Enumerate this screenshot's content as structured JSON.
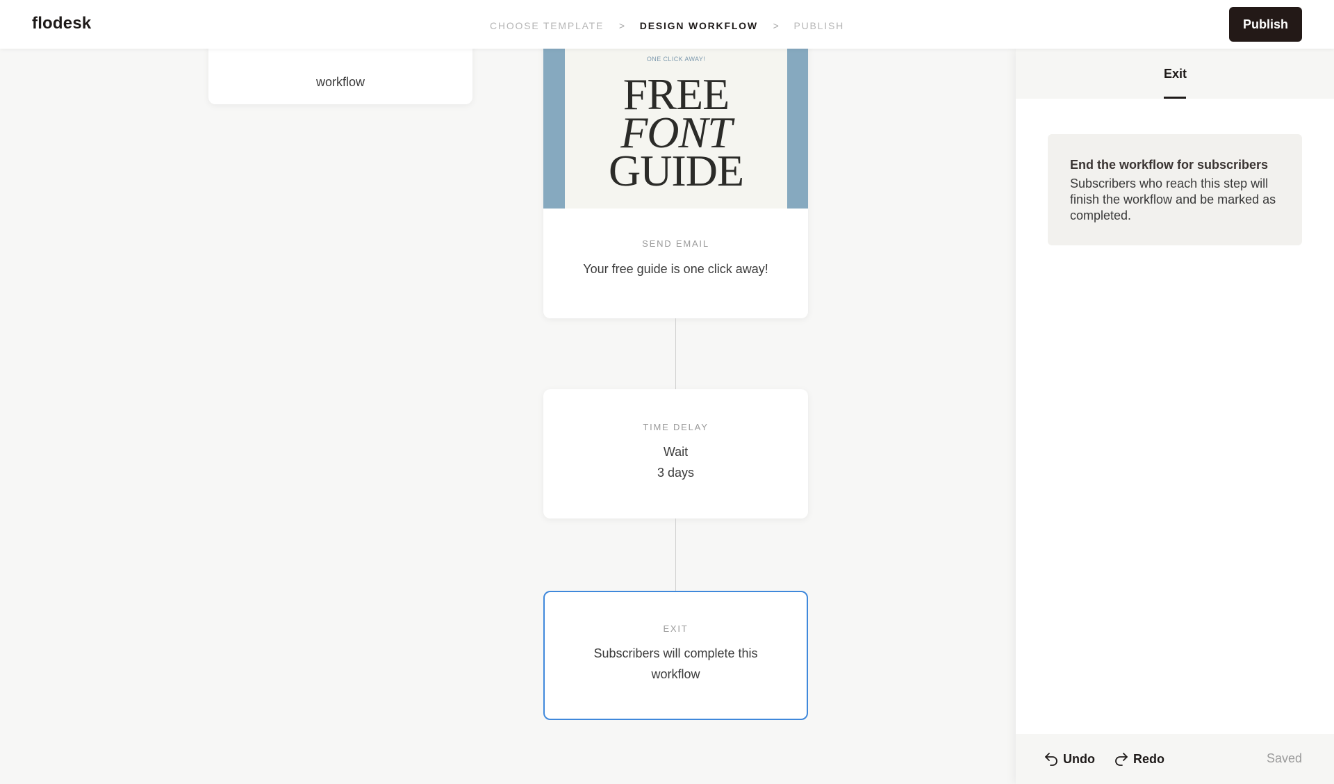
{
  "header": {
    "logo": "flodesk",
    "steps": [
      "CHOOSE TEMPLATE",
      "DESIGN WORKFLOW",
      "PUBLISH"
    ],
    "separator": ">",
    "active_step": "DESIGN WORKFLOW",
    "publish_label": "Publish"
  },
  "canvas": {
    "partial_node": {
      "text": "workflow"
    },
    "email_node": {
      "image_tagline": "ONE CLICK AWAY!",
      "image_title_1": "FREE",
      "image_title_2": "FONT",
      "image_title_3": "GUIDE",
      "label": "SEND EMAIL",
      "text": "Your free guide is one click away!"
    },
    "delay_node": {
      "label": "TIME DELAY",
      "line1": "Wait",
      "line2": "3 days"
    },
    "exit_node": {
      "label": "EXIT",
      "text_line1": "Subscribers will complete this",
      "text_line2": "workflow"
    }
  },
  "panel": {
    "tab": "Exit",
    "info_title": "End the workflow for subscribers",
    "info_desc": "Subscribers who reach this step will finish the workflow and be marked as completed.",
    "undo_label": "Undo",
    "redo_label": "Redo",
    "status": "Saved"
  },
  "colors": {
    "accent": "#3f88db",
    "publish_bg": "#231917",
    "email_frame": "#86a9bf"
  }
}
